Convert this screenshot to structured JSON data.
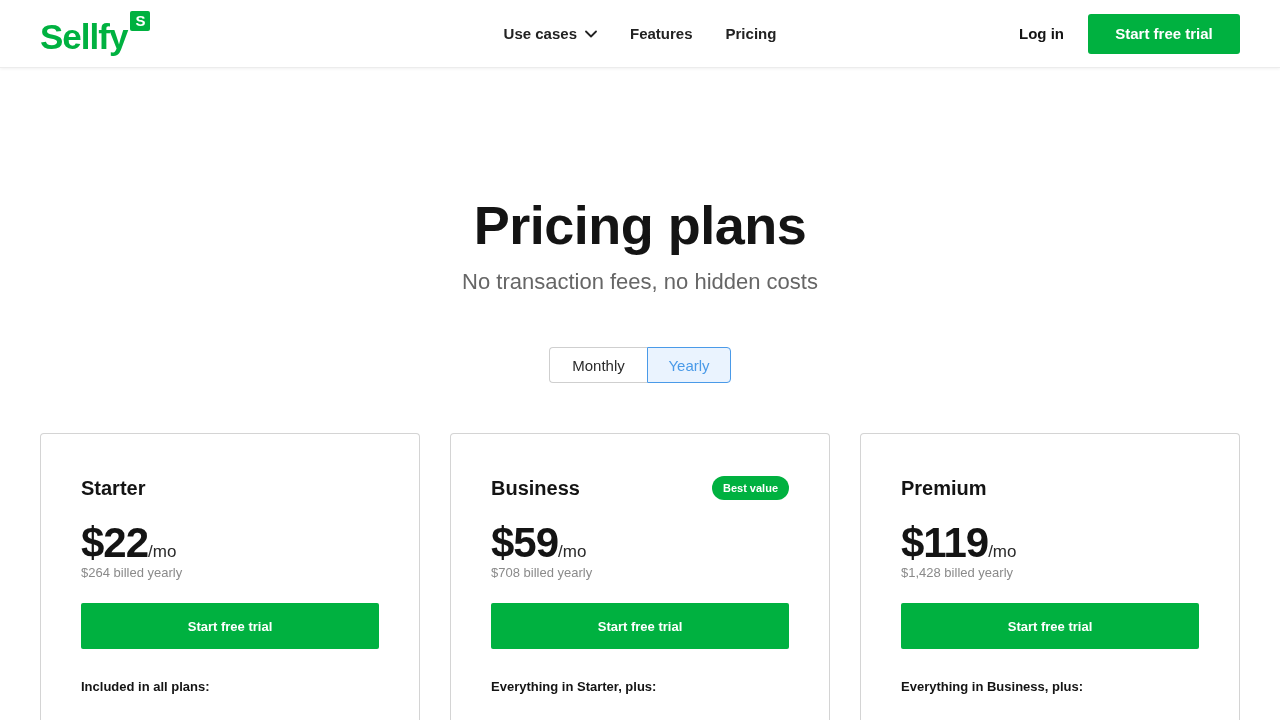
{
  "header": {
    "logo": {
      "wordmark": "Sellfy",
      "badge": "S"
    },
    "nav": [
      {
        "label": "Use cases",
        "kind": "dropdown"
      },
      {
        "label": "Features",
        "kind": "link"
      },
      {
        "label": "Pricing",
        "kind": "link"
      }
    ],
    "login": "Log in",
    "cta": "Start free trial"
  },
  "hero": {
    "title": "Pricing plans",
    "subtitle": "No transaction fees, no hidden costs"
  },
  "billing_toggle": [
    {
      "label": "Monthly",
      "selected": false
    },
    {
      "label": "Yearly",
      "selected": true
    }
  ],
  "plans": [
    {
      "name": "Starter",
      "price": "$22",
      "period": "/mo",
      "billed": "$264 billed yearly",
      "button": "Start free trial",
      "features_heading": "Included in all plans:"
    },
    {
      "name": "Business",
      "badge": "Best value",
      "price": "$59",
      "period": "/mo",
      "billed": "$708 billed yearly",
      "button": "Start free trial",
      "features_heading": "Everything in Starter, plus:"
    },
    {
      "name": "Premium",
      "price": "$119",
      "period": "/mo",
      "billed": "$1,428 billed yearly",
      "button": "Start free trial",
      "features_heading": "Everything in Business, plus:"
    }
  ]
}
